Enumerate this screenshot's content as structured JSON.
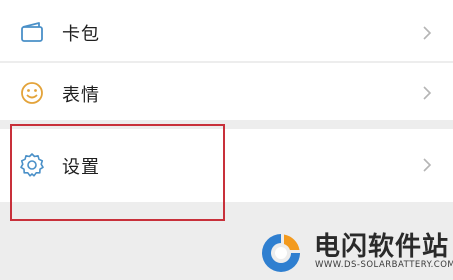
{
  "menu": {
    "items": [
      {
        "label": "卡包",
        "icon": "card-wallet-icon"
      },
      {
        "label": "表情",
        "icon": "smiley-icon"
      },
      {
        "label": "设置",
        "icon": "gear-icon"
      }
    ]
  },
  "colors": {
    "highlight": "#c8303a",
    "icon_blue": "#4a90c8",
    "icon_yellow": "#e3a33a",
    "logo_blue": "#2f7fd0",
    "logo_orange": "#f39a1e"
  },
  "watermark": {
    "title": "电闪软件站",
    "url": "WWW.DS-SOLARBATTERY.COM"
  }
}
